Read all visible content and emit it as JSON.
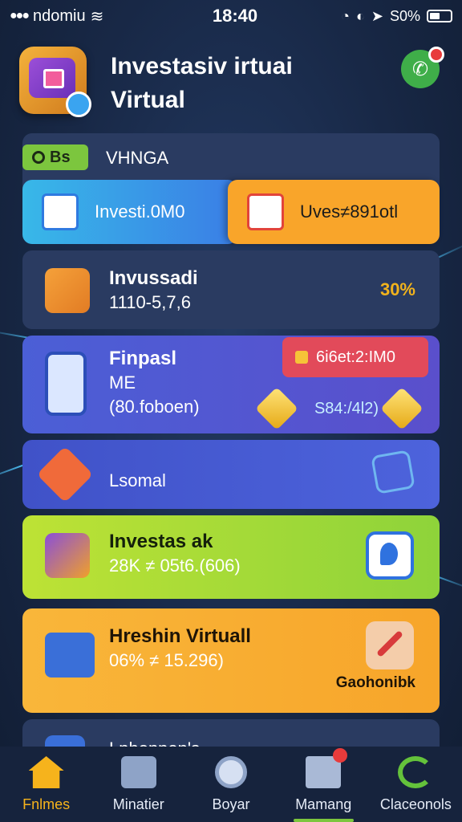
{
  "status_bar": {
    "carrier": "ndomiu",
    "time": "18:40",
    "battery": "S0%"
  },
  "header": {
    "title_line1": "Investasiv irtuai",
    "title_line2": "Virtual"
  },
  "top_card": {
    "tag": "Bs",
    "label": "VHNGA",
    "left_pill": "Investi.0M0",
    "right_pill": "Uves≠891otl"
  },
  "card_2": {
    "title": "Invussadi",
    "subtitle": "1110-5,7,6",
    "percent": "30%"
  },
  "card_3": {
    "title": "Finpasl",
    "line2": "ME",
    "line3": "(80.foboen)",
    "badge": "6i6et:2:IM0",
    "amount": "S84:/4l2)"
  },
  "card_4": {
    "title": "Lsomal"
  },
  "card_5": {
    "title": "Investas ak",
    "subtitle": "28K ≠ 05t6.(606)"
  },
  "card_6": {
    "title": "Hreshin Virtuall",
    "subtitle": "06% ≠ 15.296)",
    "side_label": "Gaohonibk"
  },
  "card_7": {
    "title": "Lnhennen's"
  },
  "bottom_nav": [
    {
      "label": "Fnlmes",
      "icon": "home-icon"
    },
    {
      "label": "Minatier",
      "icon": "document-icon"
    },
    {
      "label": "Boyar",
      "icon": "search-icon"
    },
    {
      "label": "Mamang",
      "icon": "mail-icon"
    },
    {
      "label": "Claceonols",
      "icon": "refresh-icon"
    }
  ],
  "colors": {
    "background": "#182846",
    "accent_yellow": "#f6b31c",
    "accent_green": "#7cc63e",
    "card_purple": "#4b5fd6",
    "card_lime": "#bde235",
    "card_orange": "#f9a52a"
  }
}
